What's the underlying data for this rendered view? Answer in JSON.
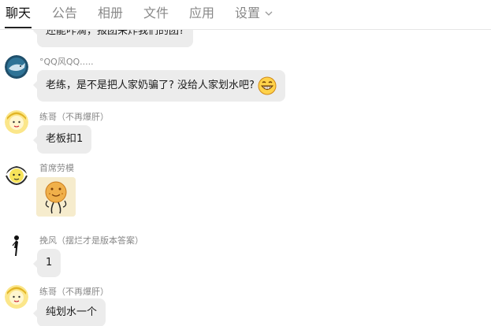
{
  "tabs": [
    {
      "label": "聊天",
      "active": true
    },
    {
      "label": "公告",
      "active": false
    },
    {
      "label": "相册",
      "active": false
    },
    {
      "label": "文件",
      "active": false
    },
    {
      "label": "应用",
      "active": false
    },
    {
      "label": "设置",
      "active": false
    }
  ],
  "messages": [
    {
      "nick": "",
      "text": "还能咋滴，报团来炸我们的团?"
    },
    {
      "nick": "°QQ风QQ.....",
      "text": "老练，是不是把人家奶骗了? 没给人家划水吧?",
      "emoji": "grinning-emoji-icon"
    },
    {
      "nick": "练哥（不再爆肝）",
      "text": "老板扣1"
    },
    {
      "nick": "首席劳模",
      "sticker": "cookie-sticker-icon"
    },
    {
      "nick": "挽风（摆烂才是版本答案）",
      "text": "1"
    },
    {
      "nick": "练哥（不再爆肝）",
      "text": "纯划水一个"
    }
  ],
  "colors": {
    "bubble": "#ececec",
    "tab_inactive": "#888888",
    "tab_active": "#111111"
  }
}
